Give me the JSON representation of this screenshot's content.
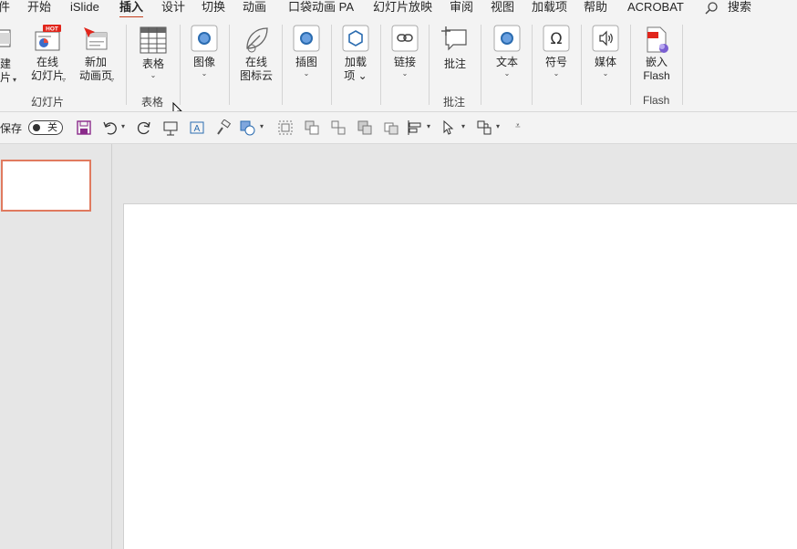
{
  "menu": {
    "tabs": [
      {
        "label": "件"
      },
      {
        "label": "开始"
      },
      {
        "label": "iSlide"
      },
      {
        "label": "插入"
      },
      {
        "label": "设计"
      },
      {
        "label": "切换"
      },
      {
        "label": "动画"
      },
      {
        "label": "口袋动画 PA"
      },
      {
        "label": "幻灯片放映"
      },
      {
        "label": "审阅"
      },
      {
        "label": "视图"
      },
      {
        "label": "加载项"
      },
      {
        "label": "帮助"
      },
      {
        "label": "ACROBAT"
      }
    ],
    "active_tab": "插入",
    "search_label": "搜索"
  },
  "ribbon": {
    "new_slide": {
      "line1": "建",
      "line2": "片"
    },
    "online_slide": {
      "line1": "在线",
      "line2": "幻灯片",
      "badge": "HOT"
    },
    "new_anim_page": {
      "line1": "新加",
      "line2": "动画页"
    },
    "group_slides": "幻灯片",
    "table": {
      "line1": "表格"
    },
    "group_tables": "表格",
    "images": {
      "line1": "图像"
    },
    "online_icons": {
      "line1": "在线",
      "line2": "图标云"
    },
    "illustrations": {
      "line1": "插图"
    },
    "addins": {
      "line1": "加载",
      "line2": "项"
    },
    "links": {
      "line1": "链接"
    },
    "comment": {
      "line1": "批注"
    },
    "group_comments": "批注",
    "text": {
      "line1": "文本"
    },
    "symbols": {
      "line1": "符号"
    },
    "media": {
      "line1": "媒体"
    },
    "embed_flash": {
      "line1": "嵌入",
      "line2": "Flash"
    },
    "group_flash": "Flash"
  },
  "qat": {
    "autosave_label": "保存",
    "autosave_state": "关"
  },
  "colors": {
    "accent": "#c43e1c",
    "thumb_border": "#e07a5f",
    "icon_blue": "#2b6cb0",
    "save_purple": "#8a2a8a"
  }
}
